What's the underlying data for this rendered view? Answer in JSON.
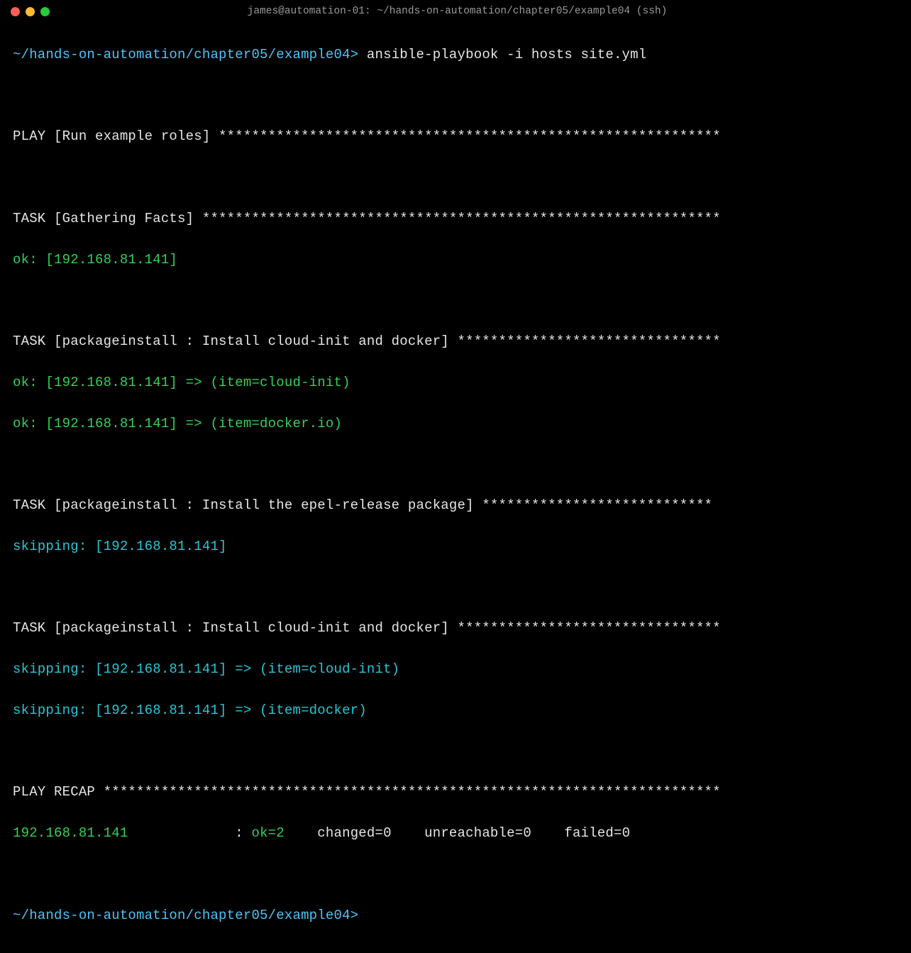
{
  "window": {
    "title": "james@automation-01: ~/hands-on-automation/chapter05/example04 (ssh)"
  },
  "prompt": {
    "path": "~/hands-on-automation/chapter05/example04>"
  },
  "command": "ansible-playbook -i hosts site.yml",
  "output": {
    "play_header": "PLAY [Run example roles] *************************************************************",
    "task1_header": "TASK [Gathering Facts] ***************************************************************",
    "task1_line1": "ok: [192.168.81.141]",
    "task2_header": "TASK [packageinstall : Install cloud-init and docker] ********************************",
    "task2_line1": "ok: [192.168.81.141] => (item=cloud-init)",
    "task2_line2": "ok: [192.168.81.141] => (item=docker.io)",
    "task3_header": "TASK [packageinstall : Install the epel-release package] ****************************",
    "task3_line1": "skipping: [192.168.81.141]",
    "task4_header": "TASK [packageinstall : Install cloud-init and docker] ********************************",
    "task4_line1": "skipping: [192.168.81.141] => (item=cloud-init) ",
    "task4_line2": "skipping: [192.168.81.141] => (item=docker) ",
    "recap_header": "PLAY RECAP ***************************************************************************",
    "recap_host": "192.168.81.141",
    "recap_sep": "             : ",
    "recap_ok": "ok=2",
    "recap_rest": "    changed=0    unreachable=0    failed=0   "
  }
}
